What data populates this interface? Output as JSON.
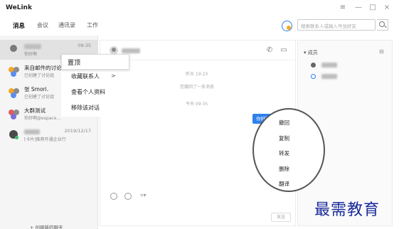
{
  "app": {
    "title": "WeLink"
  },
  "window_controls": {
    "menu": "≡",
    "minimize": "—",
    "maximize": "□",
    "close": "×"
  },
  "nav": {
    "tabs": [
      "消息",
      "会议",
      "通讯录",
      "工作"
    ],
    "active": 0
  },
  "search": {
    "placeholder": "搜索联系人或输入号加好友"
  },
  "conversations": [
    {
      "name": "",
      "preview": "你好啊",
      "time": "09:35",
      "selected": true
    },
    {
      "name": "来自邮件的讨论",
      "preview": "已创建了讨论组",
      "time": ""
    },
    {
      "name": "张           Smori.",
      "preview": "已创建了讨论组",
      "time": ""
    },
    {
      "name": "大群测试",
      "preview": "你好啊@espace...",
      "time": ""
    },
    {
      "name": "",
      "preview": "[卡片]推荐开通企业行",
      "time": "2019/12/17"
    }
  ],
  "new_chat": "+ 创建新的聊天",
  "context_menu": {
    "pin": "置顶",
    "items": [
      "收藏联系人",
      "查看个人资料",
      "移除该对话"
    ],
    "submenu_arrow": ">"
  },
  "chat": {
    "system_messages": [
      {
        "text": "昨天 19:23"
      },
      {
        "text": "您撤回了一条消息"
      },
      {
        "text": "今天 09:35"
      }
    ],
    "bubble": "你好啊",
    "send_label": "发送"
  },
  "message_menu": {
    "items": [
      "撤回",
      "复制",
      "转发",
      "删除",
      "翻译"
    ]
  },
  "members": {
    "title": "▾ 成员",
    "collapse": "⊟"
  },
  "watermark": "最需教育",
  "colors": {
    "accent": "#2f80ed",
    "watermark": "#1a2a9a"
  }
}
